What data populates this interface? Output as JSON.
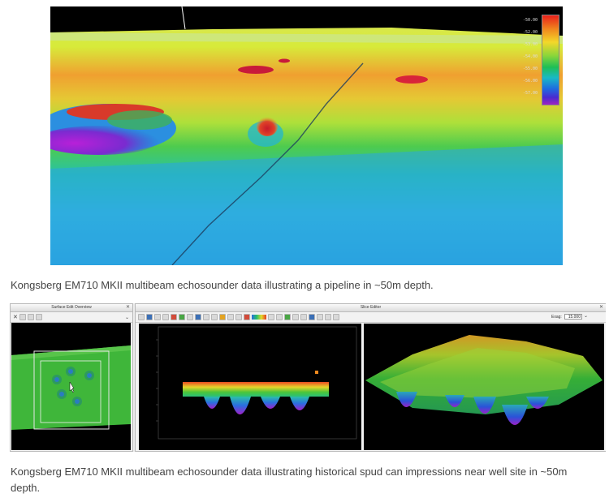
{
  "top_figure": {
    "legend": {
      "labels": [
        "-50.00",
        "-52.00",
        "-53.00",
        "-54.00",
        "-55.00",
        "-56.00",
        "-57.00"
      ]
    },
    "caption": "Kongsberg EM710 MKII multibeam echosounder data illustrating a pipeline in ~50m depth."
  },
  "bottom_figure": {
    "left_window": {
      "title": "Surface Edit Overview"
    },
    "right_window": {
      "title": "Slice Editor",
      "exag_label": "Exag:",
      "exag_value": "15.000"
    },
    "caption": "Kongsberg EM710 MKII multibeam echosounder data illustrating historical spud can impressions near well site in ~50m depth."
  },
  "icons": {
    "window_controls": "pin-icon, close-icon",
    "toolbar": "tool-icons"
  }
}
